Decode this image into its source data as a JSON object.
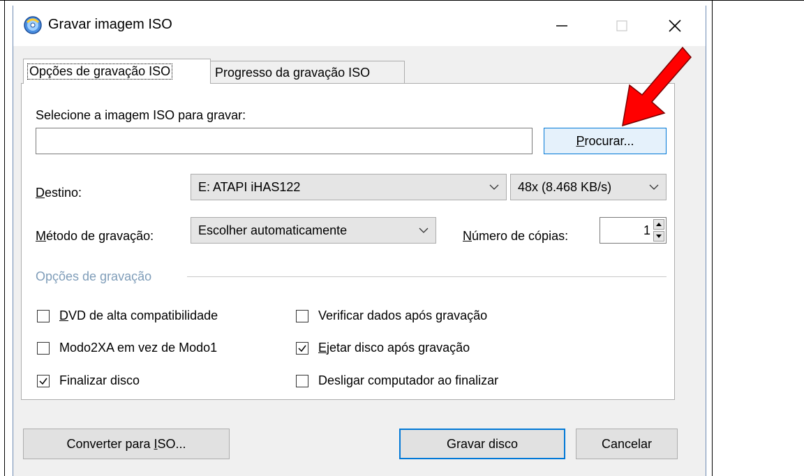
{
  "window": {
    "title": "Gravar imagem ISO",
    "min_glyph": "—",
    "close_glyph": "✕"
  },
  "tabs": [
    {
      "label": "Opções de gravação ISO",
      "active": true
    },
    {
      "label": "Progresso da gravação ISO",
      "active": false
    }
  ],
  "image": {
    "label": "Selecione a imagem ISO para gravar:",
    "path_value": "",
    "browse_label_pre": "",
    "browse_label_u": "P",
    "browse_label_post": "rocurar..."
  },
  "destination": {
    "label_u": "D",
    "label_rest": "estino:",
    "drive": "E: ATAPI iHAS122",
    "speed": "48x (8.468 KB/s)"
  },
  "method": {
    "label_u": "M",
    "label_rest": "étodo de gravação:",
    "value": "Escolher automaticamente"
  },
  "copies": {
    "label_u": "N",
    "label_rest": "úmero de cópias:",
    "value": "1"
  },
  "options": {
    "group_title": "Opções de gravação",
    "items": [
      {
        "pre": "",
        "u": "D",
        "post": "VD de alta compatibilidade",
        "checked": false
      },
      {
        "pre": "",
        "u": "",
        "post": "Modo2XA em vez de Modo1",
        "checked": false
      },
      {
        "pre": "",
        "u": "",
        "post": "Finalizar disco",
        "checked": true
      },
      {
        "pre": "",
        "u": "",
        "post": "Verificar dados após gravação",
        "checked": false
      },
      {
        "pre": "",
        "u": "E",
        "post": "jetar disco após gravação",
        "checked": true
      },
      {
        "pre": "",
        "u": "",
        "post": "Desligar computador ao finalizar",
        "checked": false
      }
    ]
  },
  "footer": {
    "convert_pre": "Converter para ",
    "convert_u": "I",
    "convert_post": "SO...",
    "burn_label": "Gravar disco",
    "cancel_label": "Cancelar"
  },
  "colors": {
    "accent": "#0078d7",
    "annotation_arrow": "#ff0000"
  }
}
